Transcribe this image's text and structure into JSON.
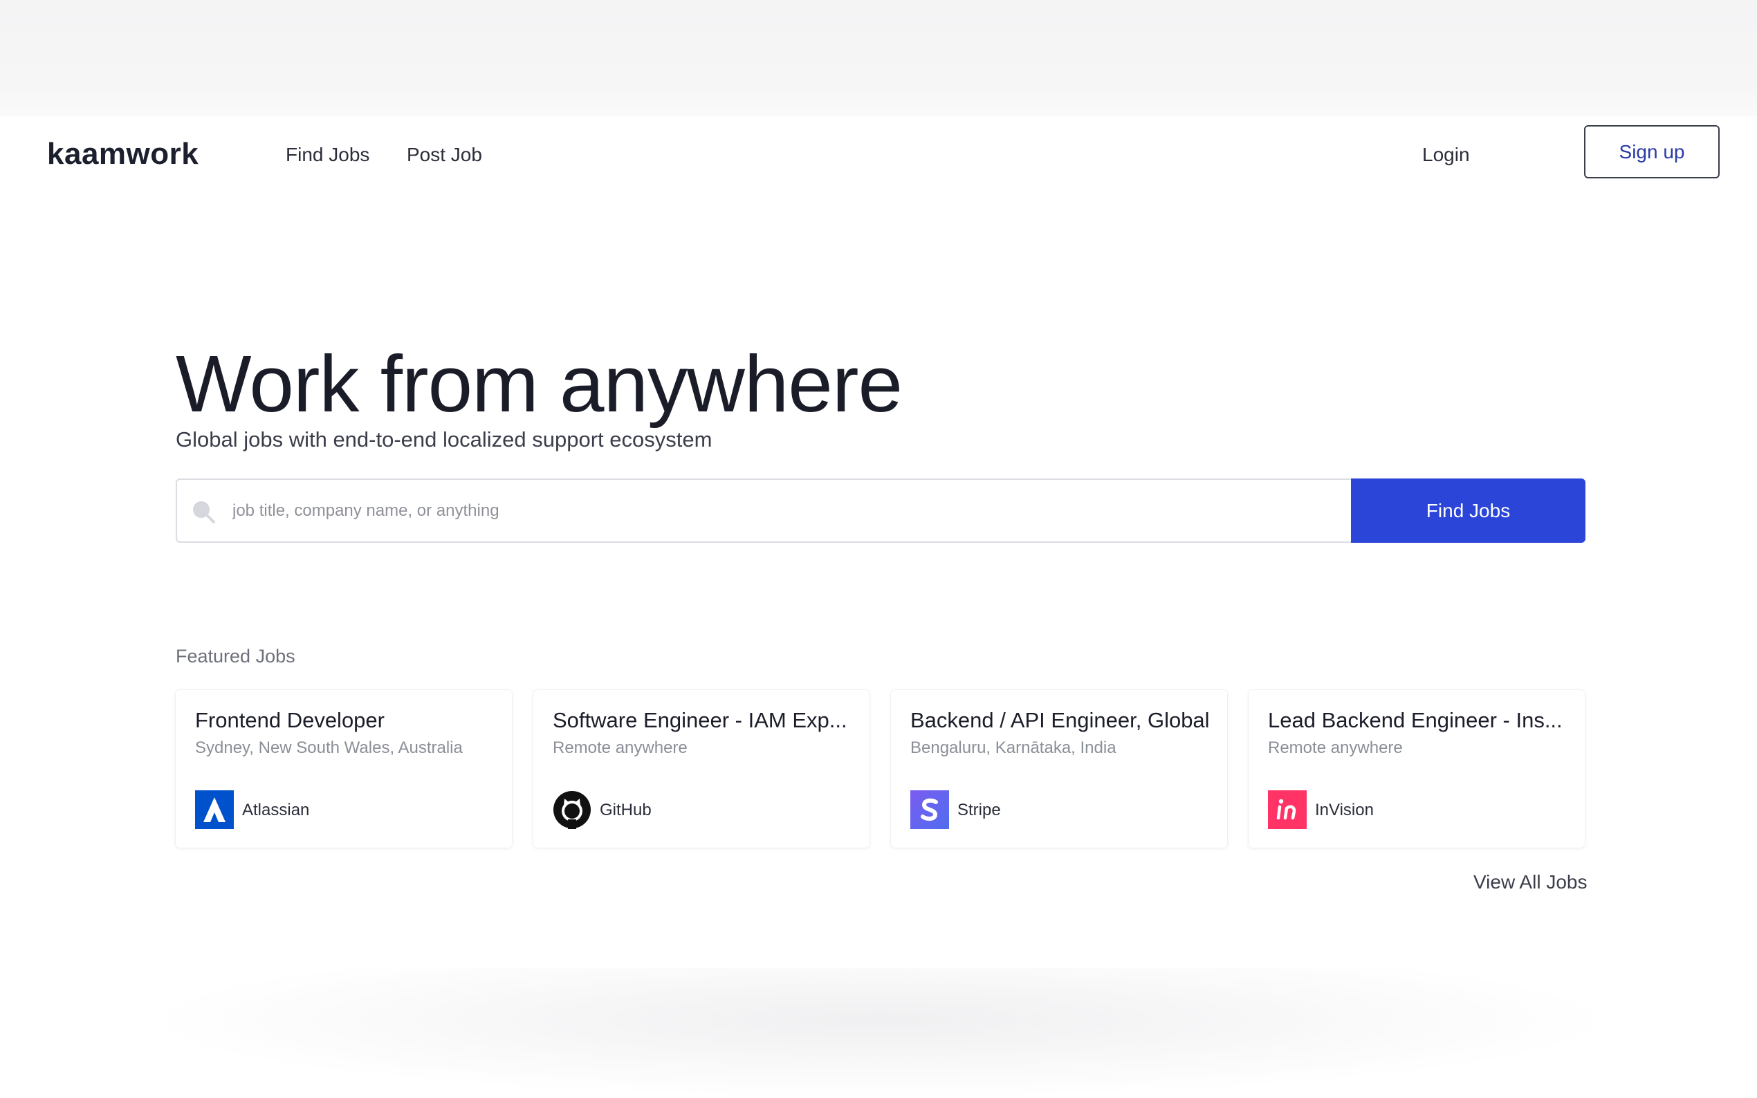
{
  "header": {
    "logo": "kaamwork",
    "nav": [
      {
        "label": "Find Jobs"
      },
      {
        "label": "Post Job"
      }
    ],
    "login_label": "Login",
    "signup_label": "Sign up"
  },
  "hero": {
    "title": "Work from anywhere",
    "subtitle": "Global jobs with end-to-end localized support ecosystem"
  },
  "search": {
    "placeholder": "job title, company name, or anything",
    "value": "",
    "button_label": "Find Jobs",
    "icon": "search-icon"
  },
  "featured": {
    "label": "Featured Jobs",
    "jobs": [
      {
        "title": "Frontend Developer",
        "location": "Sydney, New South Wales, Australia",
        "company": "Atlassian",
        "logo_icon": "atlassian-logo-icon",
        "logo_color": "#0052CC"
      },
      {
        "title": "Software Engineer - IAM Exp...",
        "location": "Remote anywhere",
        "company": "GitHub",
        "logo_icon": "github-logo-icon",
        "logo_color": "#111111"
      },
      {
        "title": "Backend / API Engineer, Global",
        "location": "Bengaluru, Karnātaka, India",
        "company": "Stripe",
        "logo_icon": "stripe-logo-icon",
        "logo_color": "#6772E5"
      },
      {
        "title": "Lead Backend Engineer - Ins...",
        "location": "Remote anywhere",
        "company": "InVision",
        "logo_icon": "invision-logo-icon",
        "logo_color": "#FF3366"
      }
    ],
    "view_all_label": "View All Jobs"
  },
  "colors": {
    "primary": "#2B45D9",
    "signup_text": "#2A3AA8",
    "text_dark": "#1A1C28",
    "text_muted": "#8B8E97"
  }
}
